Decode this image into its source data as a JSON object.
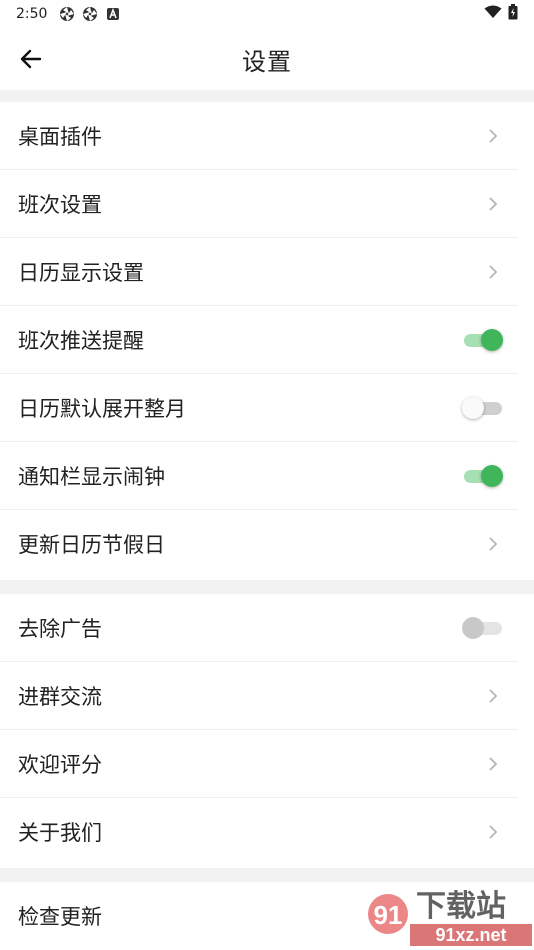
{
  "status_bar": {
    "time": "2:50"
  },
  "app_bar": {
    "title": "设置"
  },
  "groups": [
    {
      "rows": [
        {
          "label": "桌面插件",
          "control": "chevron"
        },
        {
          "label": "班次设置",
          "control": "chevron"
        },
        {
          "label": "日历显示设置",
          "control": "chevron"
        },
        {
          "label": "班次推送提醒",
          "control": "toggle",
          "checked": true
        },
        {
          "label": "日历默认展开整月",
          "control": "toggle",
          "checked": false
        },
        {
          "label": "通知栏显示闹钟",
          "control": "toggle",
          "checked": true
        },
        {
          "label": "更新日历节假日",
          "control": "chevron"
        }
      ]
    },
    {
      "rows": [
        {
          "label": "去除广告",
          "control": "toggle",
          "checked": false,
          "disabled": true
        },
        {
          "label": "进群交流",
          "control": "chevron"
        },
        {
          "label": "欢迎评分",
          "control": "chevron"
        },
        {
          "label": "关于我们",
          "control": "chevron"
        }
      ]
    },
    {
      "rows": [
        {
          "label": "检查更新",
          "control": "none"
        }
      ]
    }
  ],
  "watermark": {
    "text": "下载站",
    "url_text": "91xz.net",
    "logo": "91"
  },
  "colors": {
    "accent": "#3fb65a",
    "accent_track": "#a7dfb4",
    "divider_gap": "#f2f2f2"
  }
}
